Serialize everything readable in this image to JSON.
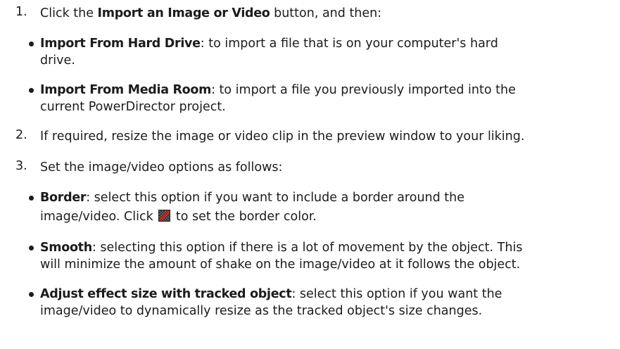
{
  "steps": [
    {
      "num": "1.",
      "pre": "Click the ",
      "bold": "Import an Image or Video",
      "post": " button, and then:"
    },
    {
      "num": "2.",
      "text": "If required, resize the image or video clip in the preview window to your liking."
    },
    {
      "num": "3.",
      "text": "Set the image/video options as follows:"
    }
  ],
  "import_options": [
    {
      "bold": "Import From Hard Drive",
      "line1": ": to import a file that is on your computer's hard",
      "line2": "drive."
    },
    {
      "bold": "Import From Media Room",
      "line1": ": to import a file you previously imported into the",
      "line2": "current PowerDirector project."
    }
  ],
  "video_options": [
    {
      "bold": "Border",
      "line1": ": select this option if you want to include a border around the",
      "line2_pre": "image/video. Click ",
      "line2_post": " to set the border color.",
      "icon": "border-color-icon"
    },
    {
      "bold": "Smooth",
      "line1": ": selecting this option if there is a lot of movement by the object. This",
      "line2": "will minimize the amount of shake on the image/video at it follows the object."
    },
    {
      "bold": "Adjust effect size with tracked object",
      "line1": ": select this option if you want the",
      "line2": "image/video to dynamically resize as the tracked object's size changes."
    }
  ]
}
